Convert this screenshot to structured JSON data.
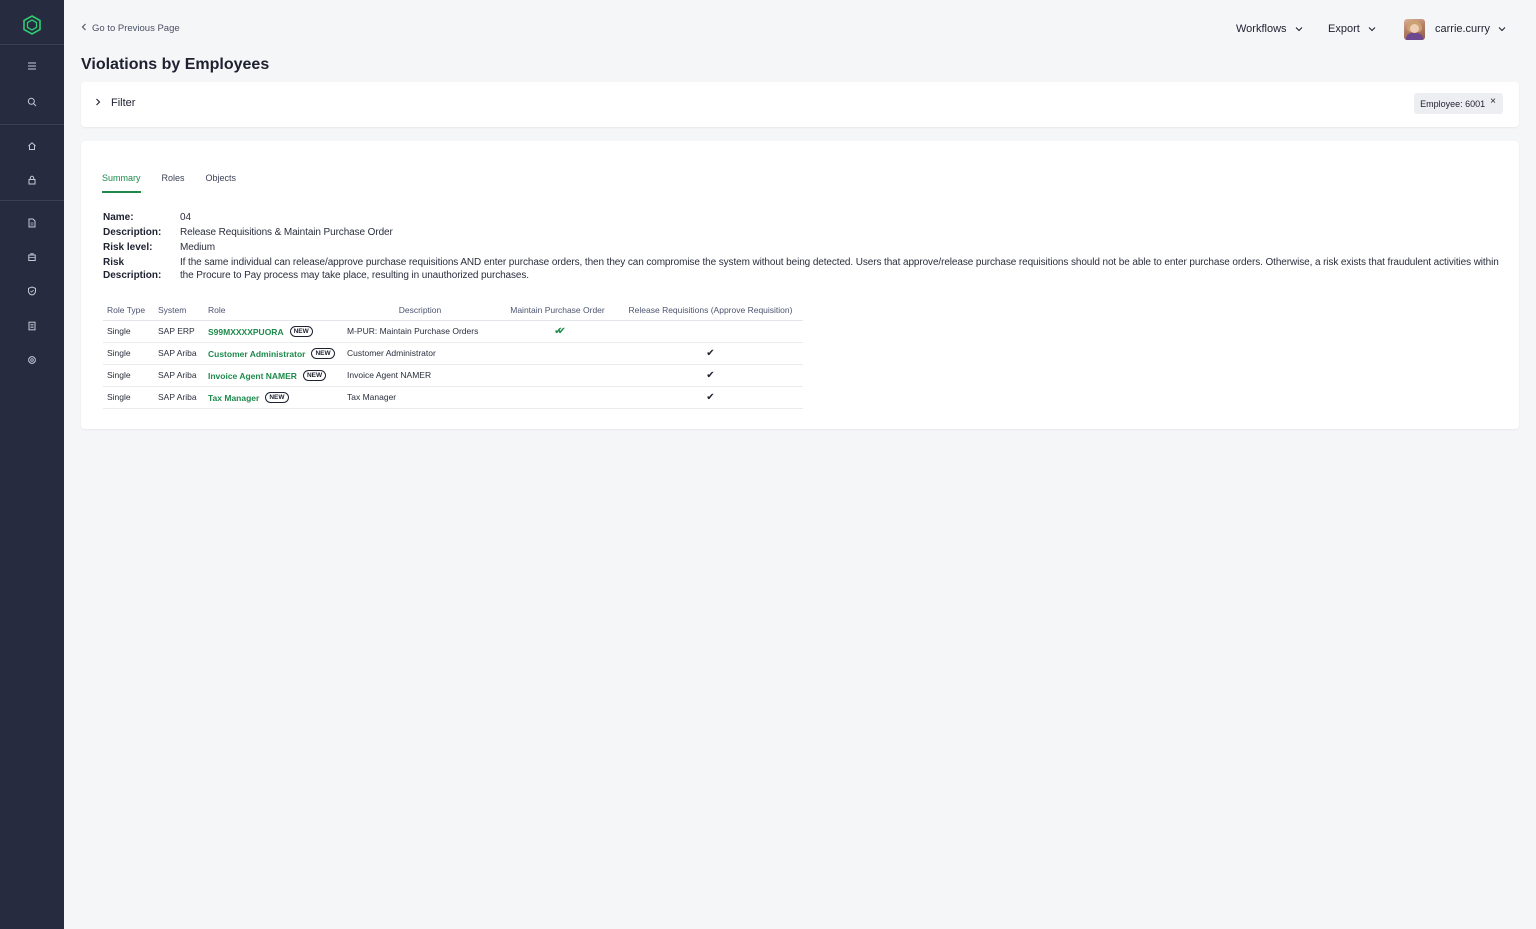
{
  "sidebar": {
    "logo": "hexagon-logo-icon",
    "items": [
      {
        "name": "menu-icon"
      },
      {
        "name": "search-icon"
      },
      {
        "name": "home-icon"
      },
      {
        "name": "lock-icon"
      },
      {
        "name": "document-icon"
      },
      {
        "name": "briefcase-icon"
      },
      {
        "name": "shield-icon"
      },
      {
        "name": "list-icon"
      },
      {
        "name": "settings-icon"
      }
    ]
  },
  "header": {
    "back_label": "Go to Previous Page",
    "title": "Violations by Employees",
    "menus": {
      "workflows": "Workflows",
      "export": "Export",
      "user": "carrie.curry"
    }
  },
  "filter": {
    "label": "Filter",
    "chip_label": "Employee: 6001",
    "chip_close": "×"
  },
  "tabs": {
    "summary": "Summary",
    "roles": "Roles",
    "objects": "Objects"
  },
  "details": {
    "name_label": "Name:",
    "name_value": "04",
    "description_label": "Description:",
    "description_value": "Release Requisitions & Maintain Purchase Order",
    "risk_level_label": "Risk level:",
    "risk_level_value": "Medium",
    "risk_description_label_1": "Risk",
    "risk_description_label_2": "Description:",
    "risk_description_value": "If the same individual can release/approve purchase requisitions AND enter purchase orders, then they can compromise the system without being detected. Users that approve/release purchase requisitions should not be able to enter purchase orders. Otherwise, a risk exists that fraudulent activities within the Procure to Pay process may take place, resulting in unauthorized purchases."
  },
  "table": {
    "headers": {
      "role_type": "Role Type",
      "system": "System",
      "role": "Role",
      "description": "Description",
      "maintain_po": "Maintain Purchase Order",
      "release_req": "Release Requisitions (Approve Requisition)"
    },
    "badge": "NEW",
    "check": "✔",
    "rows": [
      {
        "role_type": "Single",
        "system": "SAP ERP",
        "role": "S99MXXXXPUORA",
        "description": "M-PUR: Maintain Purchase Orders",
        "maintain_po": "✔✔",
        "release_req": ""
      },
      {
        "role_type": "Single",
        "system": "SAP Ariba",
        "role": "Customer Administrator",
        "description": "Customer Administrator",
        "maintain_po": "",
        "release_req": "✔"
      },
      {
        "role_type": "Single",
        "system": "SAP Ariba",
        "role": "Invoice Agent NAMER",
        "description": "Invoice Agent NAMER",
        "maintain_po": "",
        "release_req": "✔"
      },
      {
        "role_type": "Single",
        "system": "SAP Ariba",
        "role": "Tax Manager",
        "description": "Tax Manager",
        "maintain_po": "",
        "release_req": "✔"
      }
    ]
  },
  "colors": {
    "sidebar_bg": "#262b3f",
    "accent_green": "#1e8a4c",
    "page_bg": "#f5f6f8"
  }
}
